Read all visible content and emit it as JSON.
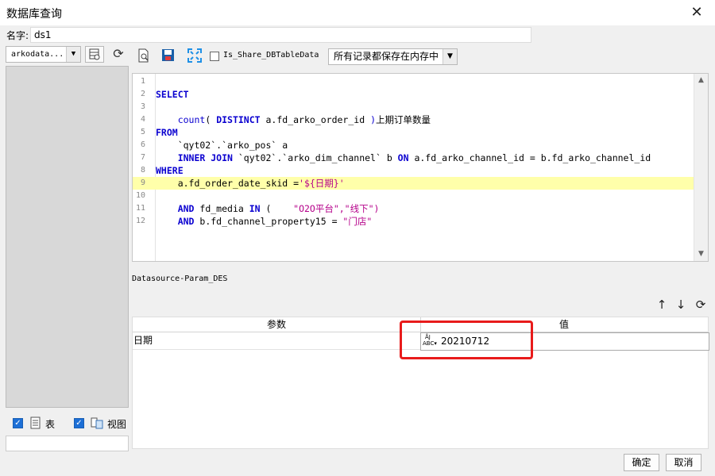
{
  "window": {
    "title": "数据库查询"
  },
  "name_field": {
    "label": "名字:",
    "value": "ds1"
  },
  "left_panel": {
    "db_select": "arkodata...",
    "table_check_label": "表",
    "view_check_label": "视图"
  },
  "toolbar": {
    "share_label": "Is_Share_DBTableData",
    "memory_select": "所有记录都保存在内存中"
  },
  "editor": {
    "lines": [
      {
        "num": "1"
      },
      {
        "num": "2",
        "tokens": [
          [
            "kw",
            "SELECT"
          ]
        ]
      },
      {
        "num": "3"
      },
      {
        "num": "4",
        "tokens": [
          [
            "txt",
            "    "
          ],
          [
            "fn",
            "count"
          ],
          [
            "txt",
            "( "
          ],
          [
            "kw",
            "DISTINCT"
          ],
          [
            "txt",
            " a.fd_arko_order_id "
          ],
          [
            "fn",
            ")"
          ],
          [
            "txt",
            "上期订单数量"
          ]
        ]
      },
      {
        "num": "5",
        "tokens": [
          [
            "kw",
            "FROM"
          ]
        ]
      },
      {
        "num": "6",
        "tokens": [
          [
            "txt",
            "    `qyt02`.`arko_pos` a"
          ]
        ]
      },
      {
        "num": "7",
        "tokens": [
          [
            "txt",
            "    "
          ],
          [
            "kw",
            "INNER JOIN"
          ],
          [
            "txt",
            " `qyt02`.`arko_dim_channel` b "
          ],
          [
            "kw",
            "ON"
          ],
          [
            "txt",
            " a.fd_arko_channel_id = b.fd_arko_channel_id"
          ]
        ]
      },
      {
        "num": "8",
        "tokens": [
          [
            "kw",
            "WHERE"
          ]
        ]
      },
      {
        "num": "9",
        "tokens": [
          [
            "txt",
            "    a.fd_order_date_skid ="
          ],
          [
            "str",
            "'${日期}'"
          ]
        ],
        "highlight": true
      },
      {
        "num": "10"
      },
      {
        "num": "11",
        "tokens": [
          [
            "txt",
            "    "
          ],
          [
            "kw",
            "AND"
          ],
          [
            "txt",
            " fd_media "
          ],
          [
            "kw",
            "IN"
          ],
          [
            "txt",
            " ( "
          ],
          [
            "str",
            "   \"O2O平台\",\"线下\")"
          ]
        ]
      },
      {
        "num": "12",
        "tokens": [
          [
            "txt",
            "    "
          ],
          [
            "kw",
            "AND"
          ],
          [
            "txt",
            " b.fd_channel_property15 = "
          ],
          [
            "str",
            "\"门店\""
          ]
        ]
      }
    ]
  },
  "params": {
    "section_label": "Datasource-Param_DES",
    "col_param": "参数",
    "col_value": "值",
    "rows": [
      {
        "name": "日期",
        "type_icon": "ABC",
        "value": "20210712"
      }
    ]
  },
  "buttons": {
    "ok": "确定",
    "cancel": "取消"
  },
  "colors": {
    "highlight_line": "#ffffaa",
    "keyword": "#0a00d0",
    "string": "#b5008a",
    "annotation_box": "#e81b1b"
  }
}
